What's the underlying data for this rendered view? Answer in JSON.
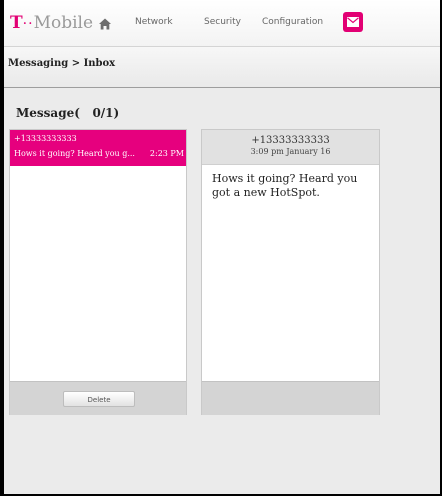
{
  "brand": {
    "t": "T",
    "dots": "··",
    "name": "Mobile"
  },
  "nav": {
    "network": "Network",
    "security": "Security",
    "configuration": "Configuration"
  },
  "breadcrumb": "Messaging > Inbox",
  "message_header": "Message(   0/1)",
  "list": {
    "items": [
      {
        "number": "+13333333333",
        "preview": "Hows it going? Heard you g...",
        "time": "2:23 PM"
      }
    ],
    "delete_label": "Delete"
  },
  "detail": {
    "number": "+13333333333",
    "date": "3:09 pm January 16",
    "body": "Hows it going? Heard you got a new HotSpot."
  },
  "colors": {
    "brand": "#e20074",
    "selected_item": "#e6007e"
  },
  "icons": [
    "home-icon",
    "mail-icon"
  ]
}
